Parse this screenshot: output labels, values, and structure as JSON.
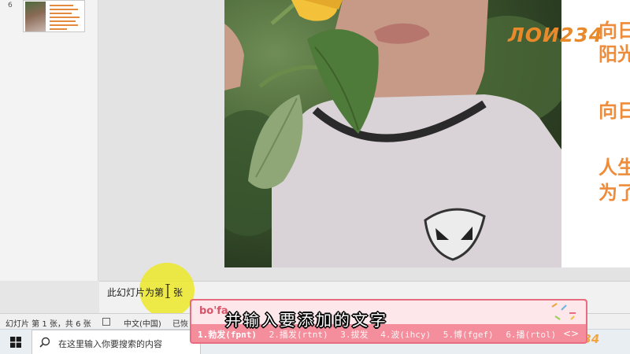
{
  "thumbnails": {
    "slide_number": "6"
  },
  "slide": {
    "logo": "ЛОИ234",
    "lines": [
      "向日",
      "阳光",
      "向日",
      "人生",
      "为了"
    ]
  },
  "notes": {
    "text_before": "此幻灯片为第",
    "text_after": "张"
  },
  "status_bar": {
    "slide_info": "幻灯片 第 1 张，共 6 张",
    "language": "中文(中国)",
    "recovery": "已恢"
  },
  "taskbar": {
    "search_placeholder": "在这里输入你要搜索的内容",
    "tray_logo": "234"
  },
  "ime": {
    "composition": "bo'fa",
    "candidates": [
      "1.勃发(fpnt)",
      "2.播发(rtnt)",
      "3.拔发",
      "4.波(ihcy)",
      "5.博(fgef)",
      "6.播(rtol)"
    ],
    "next_arrow": "<>"
  },
  "subtitle": "并输入要添加的文字",
  "colors": {
    "slide_text": "#ee8c3a",
    "ime_bg": "#f48e9c",
    "highlight": "#ece828"
  }
}
